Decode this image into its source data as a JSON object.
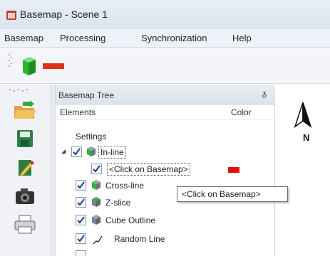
{
  "window": {
    "title": "Basemap - Scene 1"
  },
  "menu": {
    "items": [
      "Basemap",
      "Processing",
      "Synchronization",
      "Help"
    ]
  },
  "toolbar": {
    "tools": [
      "green-cube-icon",
      "red-line-icon"
    ]
  },
  "sidebar": {
    "tools": [
      "open-folder-icon",
      "save-icon",
      "edit-icon",
      "camera-icon",
      "printer-icon"
    ]
  },
  "panel": {
    "title": "Basemap Tree",
    "pin": "ᵹ",
    "columns": {
      "elements": "Elements",
      "color": "Color"
    },
    "settings_label": "Settings",
    "items": [
      {
        "label": "In-line",
        "checked": true,
        "expanded": true
      },
      {
        "label": "<Click on Basemap>",
        "checked": true,
        "color": "#e01010"
      },
      {
        "label": "Cross-line",
        "checked": true
      },
      {
        "label": "Z-slice",
        "checked": true
      },
      {
        "label": "Cube Outline",
        "checked": true
      },
      {
        "label": "Random Line",
        "checked": true
      }
    ]
  },
  "tooltip": {
    "text": "<Click on Basemap>"
  },
  "scene": {
    "north_label": "N"
  },
  "colors": {
    "accent_green": "#2fb52f",
    "line_red": "#e01010"
  }
}
